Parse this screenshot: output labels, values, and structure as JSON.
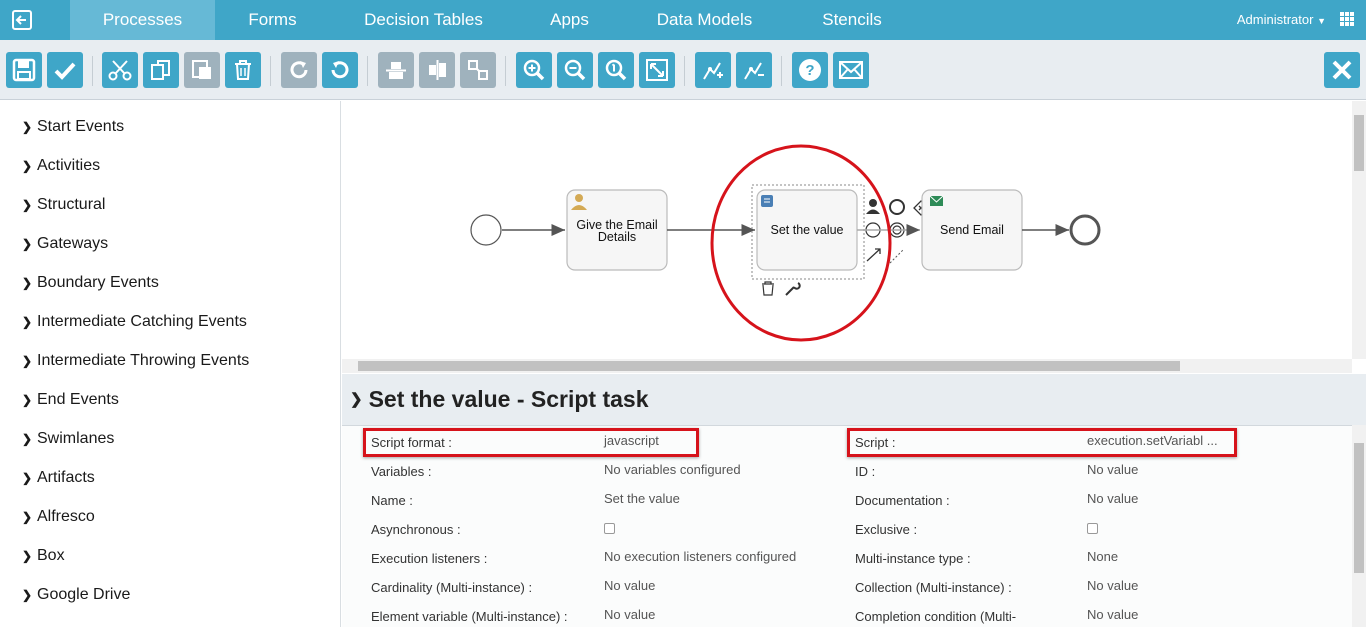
{
  "nav": {
    "tabs": [
      "Processes",
      "Forms",
      "Decision Tables",
      "Apps",
      "Data Models",
      "Stencils"
    ],
    "active_tab": "Processes",
    "user": "Administrator"
  },
  "toolbar": {
    "buttons": [
      "save",
      "validate",
      "cut",
      "copy",
      "paste",
      "delete",
      "redo",
      "undo",
      "align-horizontal",
      "align-vertical",
      "same-size",
      "zoom-in",
      "zoom-out",
      "zoom-actual",
      "zoom-fit",
      "bend-point-add",
      "bend-point-remove",
      "help",
      "feedback"
    ],
    "close": "close"
  },
  "palette": {
    "items": [
      "Start Events",
      "Activities",
      "Structural",
      "Gateways",
      "Boundary Events",
      "Intermediate Catching Events",
      "Intermediate Throwing Events",
      "End Events",
      "Swimlanes",
      "Artifacts",
      "Alfresco",
      "Box",
      "Google Drive"
    ]
  },
  "diagram": {
    "tasks": [
      "Give the Email Details",
      "Set the value",
      "Send Email"
    ],
    "task_line1": "Give the Email",
    "task_line2": "Details",
    "highlight_color": "#d6131b"
  },
  "properties": {
    "title": "Set the value - Script task",
    "rows": [
      {
        "label": "Script format :",
        "value": "javascript",
        "label2": "Script :",
        "value2": "execution.setVariabl ..."
      },
      {
        "label": "Variables :",
        "value": "No variables configured",
        "label2": "ID :",
        "value2": "No value"
      },
      {
        "label": "Name :",
        "value": "Set the value",
        "label2": "Documentation :",
        "value2": "No value"
      },
      {
        "label": "Asynchronous :",
        "value": "",
        "label2": "Exclusive :",
        "value2": ""
      },
      {
        "label": "Execution listeners :",
        "value": "No execution listeners configured",
        "label2": "Multi-instance type :",
        "value2": "None"
      },
      {
        "label": "Cardinality (Multi-instance) :",
        "value": "No value",
        "label2": "Collection (Multi-instance) :",
        "value2": "No value"
      },
      {
        "label": "Element variable (Multi-instance) :",
        "value": "No value",
        "label2": "Completion condition (Multi-",
        "value2": "No value"
      }
    ]
  },
  "colors": {
    "nav_bg": "#3fa6c8",
    "nav_active": "#66b9d6",
    "button": "#3fa6c8",
    "button_disabled": "#9fb2bd",
    "panel_bg": "#e8edf1"
  }
}
